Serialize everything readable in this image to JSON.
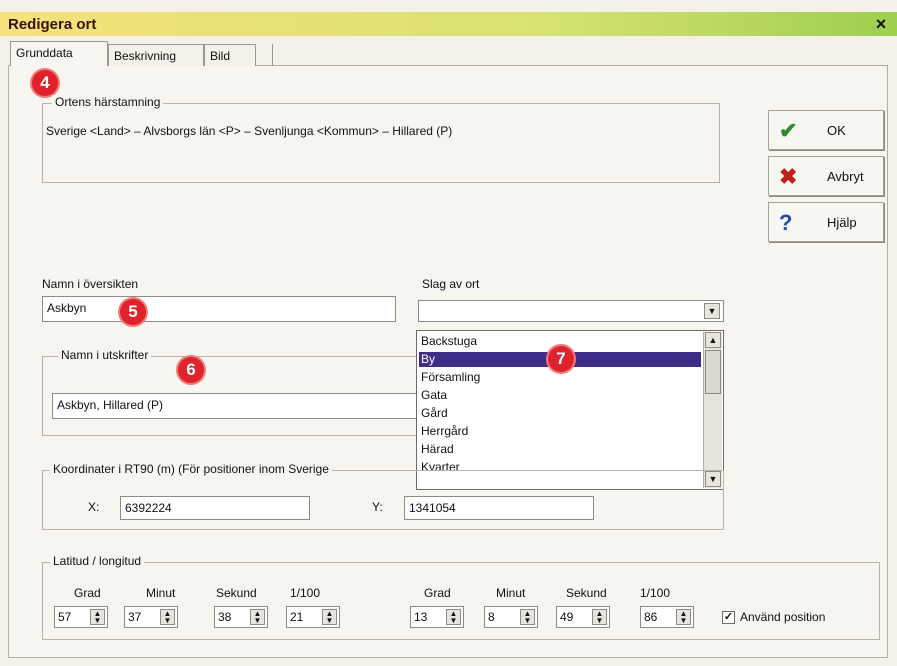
{
  "window": {
    "title": "Redigera ort",
    "close": "×"
  },
  "tabs": [
    {
      "label": "Grunddata"
    },
    {
      "label": "Beskrivning"
    },
    {
      "label": "Bild"
    }
  ],
  "badges": [
    "4",
    "5",
    "6",
    "7"
  ],
  "origin": {
    "label": "Ortens härstamning",
    "text": "Sverige <Land> – Alvsborgs län <P> – Svenljunga <Kommun> – Hillared (P)"
  },
  "buttons": {
    "ok": {
      "label": "OK",
      "icon": "check-icon",
      "color": "#2a8c2a"
    },
    "cancel": {
      "label": "Avbryt",
      "icon": "x-icon",
      "color": "#c0201c"
    },
    "help": {
      "label": "Hjälp",
      "icon": "question-icon",
      "color": "#1f4fa8"
    }
  },
  "overview_name": {
    "label": "Namn i översikten",
    "value": "Askbyn"
  },
  "place_type": {
    "label": "Slag av ort",
    "value": "",
    "options": [
      "Backstuga",
      "By",
      "Församling",
      "Gata",
      "Gård",
      "Herrgård",
      "Härad",
      "Kvarter"
    ],
    "selected": "By"
  },
  "printout_name": {
    "label": "Namn i utskrifter",
    "value": "Askbyn, Hillared (P)"
  },
  "coordinates": {
    "label": "Koordinater i RT90 (m) (För positioner inom Sverige",
    "x_label": "X:",
    "x_value": "6392224",
    "y_label": "Y:",
    "y_value": "1341054"
  },
  "latlong": {
    "label": "Latitud / longitud",
    "headers": [
      "Grad",
      "Minut",
      "Sekund",
      "1/100"
    ],
    "lat": [
      "57",
      "37",
      "38",
      "21"
    ],
    "long": [
      "13",
      "8",
      "49",
      "86"
    ],
    "use_position_label": "Använd position",
    "use_position_checked": true,
    "check_mark": "✓"
  }
}
